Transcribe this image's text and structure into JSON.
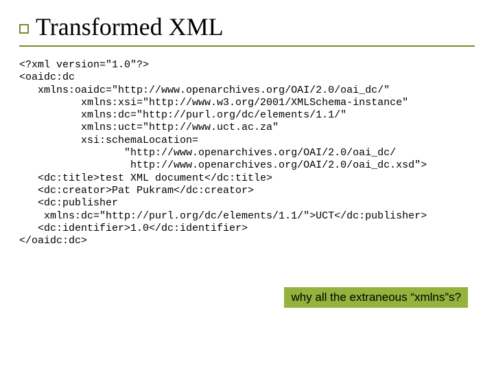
{
  "title": "Transformed XML",
  "code_lines": {
    "l1": "<?xml version=\"1.0\"?>",
    "l2": "<oaidc:dc",
    "l3": "   xmlns:oaidc=\"http://www.openarchives.org/OAI/2.0/oai_dc/\"",
    "l4": "          xmlns:xsi=\"http://www.w3.org/2001/XMLSchema-instance\"",
    "l5": "          xmlns:dc=\"http://purl.org/dc/elements/1.1/\"",
    "l6": "          xmlns:uct=\"http://www.uct.ac.za\"",
    "l7": "          xsi:schemaLocation=",
    "l8": "                 \"http://www.openarchives.org/OAI/2.0/oai_dc/",
    "l9": "                  http://www.openarchives.org/OAI/2.0/oai_dc.xsd\">",
    "l10": "   <dc:title>test XML document</dc:title>",
    "l11": "   <dc:creator>Pat Pukram</dc:creator>",
    "l12": "   <dc:publisher",
    "l13": "    xmlns:dc=\"http://purl.org/dc/elements/1.1/\">UCT</dc:publisher>",
    "l14": "   <dc:identifier>1.0</dc:identifier>",
    "l15": "</oaidc:dc>"
  },
  "callout": "why all the extraneous “xmlns”s?"
}
